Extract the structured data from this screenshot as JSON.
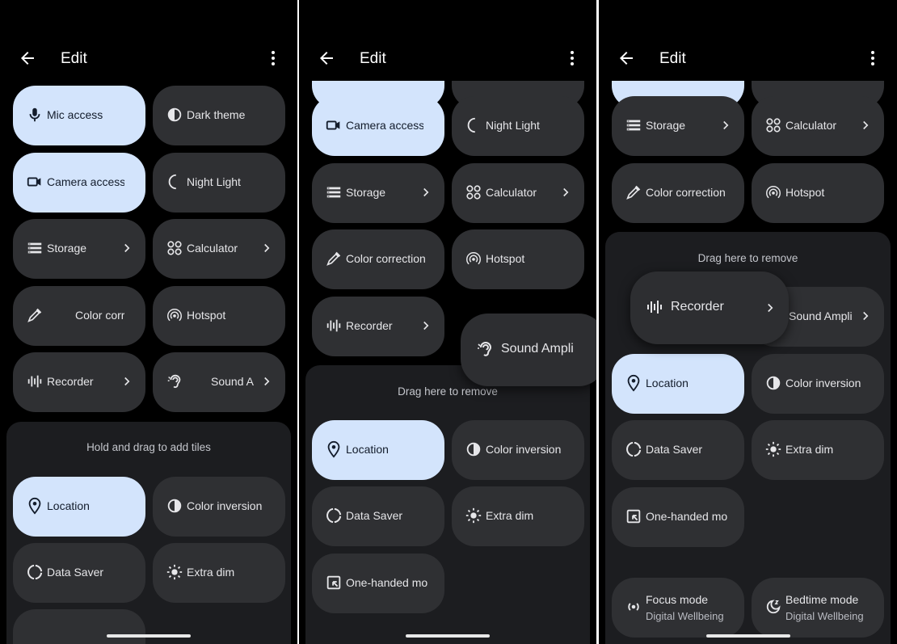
{
  "screens": [
    {
      "title": "Edit",
      "tray_hint": "Hold and drag to add tiles",
      "tiles": {
        "mic": "Mic access",
        "dark": "Dark theme",
        "camera": "Camera access",
        "night": "Night Light",
        "storage": "Storage",
        "calc": "Calculator",
        "color_corr": "Color corr",
        "hotspot": "Hotspot",
        "recorder": "Recorder",
        "sound": "Sound A"
      },
      "tray_tiles": {
        "location": "Location",
        "inversion": "Color inversion",
        "saver": "Data Saver",
        "extra": "Extra dim"
      }
    },
    {
      "title": "Edit",
      "tray_hint": "Drag here to remove",
      "tiles": {
        "camera": "Camera access",
        "night": "Night Light",
        "storage": "Storage",
        "calc": "Calculator",
        "color_corr": "Color correction",
        "hotspot": "Hotspot",
        "recorder": "Recorder",
        "sound_drag": "Sound Ampli"
      },
      "tray_tiles": {
        "location": "Location",
        "inversion": "Color inversion",
        "saver": "Data Saver",
        "extra": "Extra dim",
        "onehand": "One-handed mo"
      }
    },
    {
      "title": "Edit",
      "tray_hint": "Drag here to remove",
      "tiles": {
        "storage": "Storage",
        "calc": "Calculator",
        "color_corr": "Color correction",
        "hotspot": "Hotspot",
        "recorder_drag": "Recorder",
        "sound": "Sound Ampli"
      },
      "tray_tiles": {
        "location": "Location",
        "inversion": "Color inversion",
        "saver": "Data Saver",
        "extra": "Extra dim",
        "onehand": "One-handed mo",
        "focus": "Focus mode",
        "focus_sub": "Digital Wellbeing",
        "bedtime": "Bedtime mode",
        "bedtime_sub": "Digital Wellbeing"
      }
    }
  ],
  "colors": {
    "background": "#000000",
    "tile": "#2f3033",
    "tile_active": "#d3e4fc",
    "tray": "#1c1d20"
  },
  "icons": [
    "back-arrow-icon",
    "more-vert-icon",
    "mic-icon",
    "dark-theme-icon",
    "camera-icon",
    "night-light-icon",
    "storage-icon",
    "calculator-icon",
    "eyedropper-icon",
    "hotspot-icon",
    "recorder-icon",
    "hearing-icon",
    "location-pin-icon",
    "color-inversion-icon",
    "data-saver-icon",
    "extra-dim-icon",
    "one-handed-icon",
    "focus-mode-icon",
    "bedtime-icon",
    "chevron-right-icon"
  ]
}
